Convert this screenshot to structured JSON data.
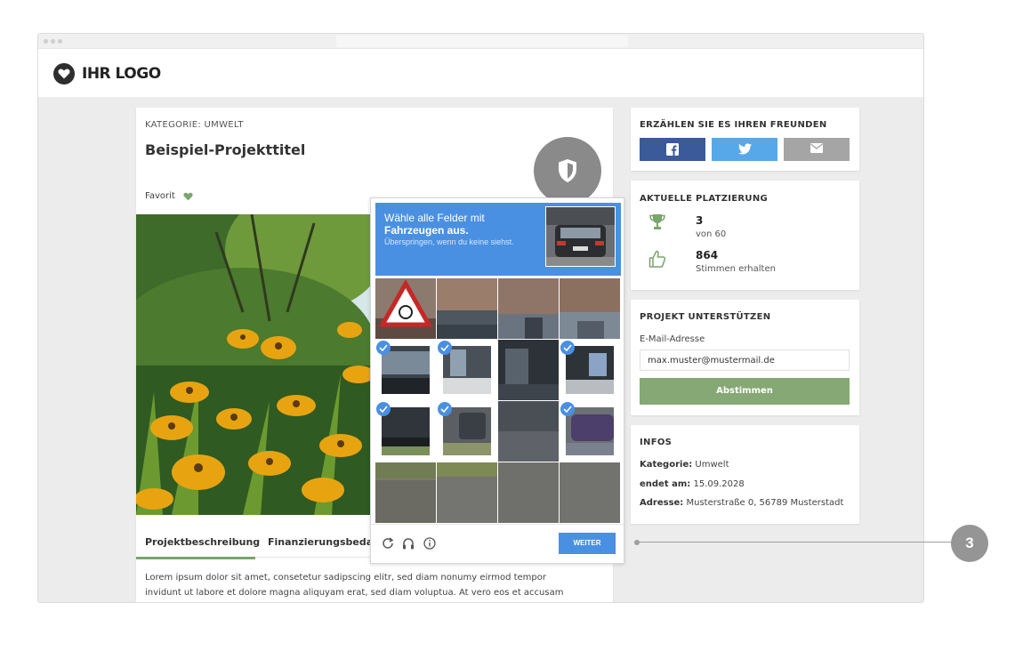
{
  "header": {
    "logo_text": "IHR LOGO"
  },
  "project": {
    "category": "KATEGORIE: UMWELT",
    "title": "Beispiel-Projekttitel",
    "favorite_label": "Favorit",
    "tabs": [
      {
        "label": "Projektbeschreibung"
      },
      {
        "label": "Finanzierungsbedarf"
      }
    ],
    "description_line1": "Lorem ipsum dolor sit amet, consetetur sadipscing elitr, sed diam nonumy eirmod tempor",
    "description_line2": "invidunt ut labore et dolore magna aliquyam erat, sed diam voluptua. At vero eos et accusam"
  },
  "share": {
    "title": "ERZÄHLEN SIE ES IHREN FREUNDEN",
    "buttons": [
      {
        "icon": "facebook-icon",
        "color": "#3b5a9a"
      },
      {
        "icon": "twitter-icon",
        "color": "#57a8e8"
      },
      {
        "icon": "mail-icon",
        "color": "#a5a5a5"
      }
    ]
  },
  "ranking": {
    "title": "AKTUELLE PLATZIERUNG",
    "place": "3",
    "place_sub": "von 60",
    "votes": "864",
    "votes_sub": "Stimmen erhalten"
  },
  "support": {
    "title": "PROJEKT UNTERSTÜTZEN",
    "email_label": "E-Mail-Adresse",
    "email_value": "max.muster@mustermail.de",
    "submit_label": "Abstimmen"
  },
  "infos": {
    "title": "INFOS",
    "category_label": "Kategorie:",
    "category_value": " Umwelt",
    "ends_label": "endet am:",
    "ends_value": " 15.09.2028",
    "address_label": "Adresse:",
    "address_value": " Musterstraße 0, 56789 Musterstadt"
  },
  "captcha": {
    "question_prefix": "Wähle alle Felder mit ",
    "question_keyword": "Fahrzeugen",
    "question_suffix": " aus.",
    "skip_hint": "Überspringen, wenn du keine siehst.",
    "selected_tiles": [
      4,
      5,
      7,
      8,
      9,
      11
    ],
    "submit_label": "WEITER",
    "footer_icons": [
      "reload-icon",
      "headphones-icon",
      "info-icon"
    ]
  },
  "callout": {
    "number": "3"
  },
  "colors": {
    "accent_green": "#86a874",
    "captcha_blue": "#4a90e2"
  }
}
